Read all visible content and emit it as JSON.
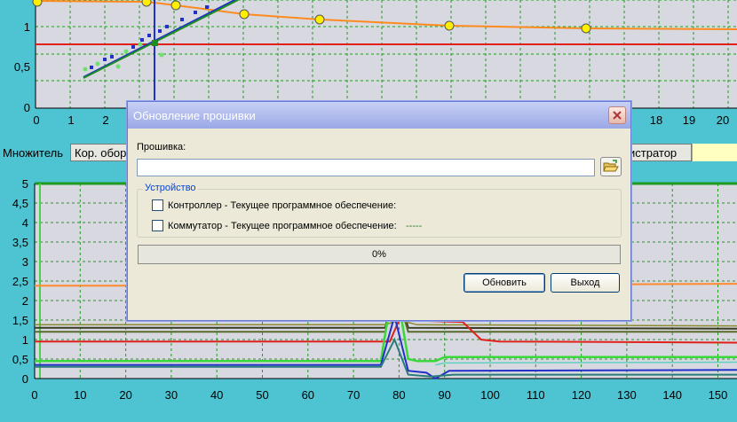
{
  "top_chart": {
    "y_ticks": [
      "0",
      "0,5",
      "1"
    ],
    "x_ticks_left": [
      "0",
      "1",
      "2"
    ],
    "x_ticks_right": [
      "18",
      "19",
      "20"
    ],
    "colors": {
      "bg": "#d8d8e0",
      "grid": "#1f9a1f",
      "red": "#e0201a",
      "orange": "#ff8a20",
      "blue": "#2030c8",
      "green": "#1e8e1e",
      "marker": "#ffee00"
    }
  },
  "tabs": {
    "multiplier": "Множитель",
    "kor": "Кор. обор",
    "registrar": "истратор"
  },
  "bottom_chart": {
    "y_ticks": [
      "0",
      "0,5",
      "1",
      "1,5",
      "2",
      "2,5",
      "3",
      "3,5",
      "4",
      "4,5",
      "5"
    ],
    "x_ticks": [
      "0",
      "10",
      "20",
      "30",
      "40",
      "50",
      "60",
      "70",
      "80",
      "90",
      "100",
      "110",
      "120",
      "130",
      "140",
      "150"
    ],
    "colors": {
      "bg": "#d8d8e0",
      "grid": "#1f9a1f",
      "frame": "#1f9a1f"
    }
  },
  "dialog": {
    "title": "Обновление прошивки",
    "firmware_label": "Прошивка:",
    "firmware_value": "",
    "device_group": "Устройство",
    "controller_label": "Контроллер  - Текущее программное обеспечение:",
    "commutator_label": "Коммутатор - Текущее программное обеспечение:",
    "commutator_value": "-----",
    "progress": "0%",
    "update_button": "Обновить",
    "exit_button": "Выход"
  }
}
